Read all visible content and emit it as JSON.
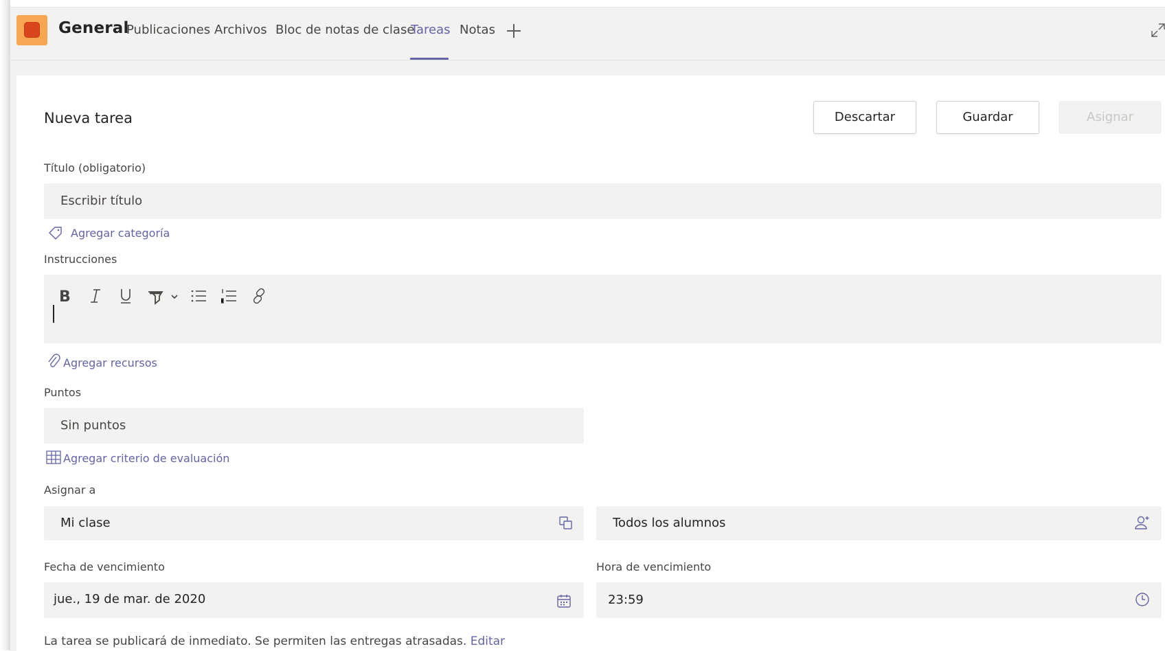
{
  "header": {
    "channel_name": "General",
    "tabs": [
      {
        "label": "Publicaciones"
      },
      {
        "label": "Archivos"
      },
      {
        "label": "Bloc de notas de clase"
      },
      {
        "label": "Tareas"
      },
      {
        "label": "Notas"
      }
    ],
    "active_tab": "Tareas",
    "accent_color": "#6264a7"
  },
  "form": {
    "title": "Nueva tarea",
    "buttons": {
      "discard": "Descartar",
      "save": "Guardar",
      "assign": "Asignar"
    },
    "title_label": "Título (obligatorio)",
    "title_placeholder": "Escribir título",
    "add_category": "Agregar categoría",
    "instructions_label": "Instrucciones",
    "toolbar_icons": [
      "bold-icon",
      "italic-icon",
      "underline-icon",
      "highlight-icon",
      "bullet-list-icon",
      "numbered-list-icon",
      "link-icon"
    ],
    "add_resources": "Agregar recursos",
    "points_label": "Puntos",
    "points_value": "Sin puntos",
    "add_rubric": "Agregar criterio de evaluación",
    "assign_to_label": "Asignar a",
    "class_value": "Mi clase",
    "students_value": "Todos los alumnos",
    "due_date_label": "Fecha de vencimiento",
    "due_date_value": "jue., 19 de mar. de 2020",
    "due_time_label": "Hora de vencimiento",
    "due_time_value": "23:59",
    "footer_text": "La tarea se publicará de inmediato. Se permiten las entregas atrasadas.",
    "footer_link": "Editar"
  }
}
